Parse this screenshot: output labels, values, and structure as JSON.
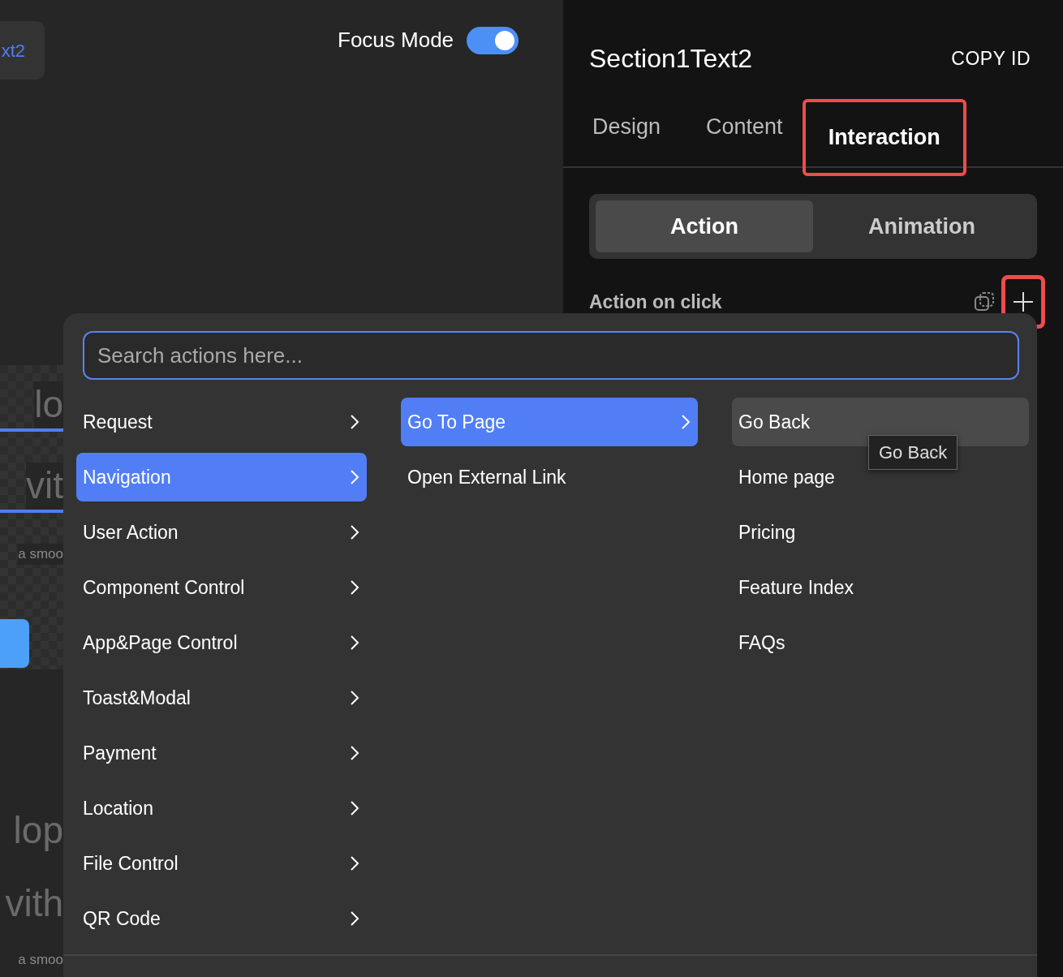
{
  "canvas": {
    "element_tag": "xt2",
    "focus_mode": {
      "label": "Focus Mode",
      "on": true
    },
    "fragments": [
      {
        "kind": "heading",
        "text": "lo"
      },
      {
        "kind": "heading",
        "text": "vit"
      },
      {
        "kind": "caption",
        "text": "a smoo"
      },
      {
        "kind": "button"
      },
      {
        "kind": "heading",
        "text": "lop"
      },
      {
        "kind": "heading",
        "text": "vith"
      },
      {
        "kind": "caption",
        "text": "a smoo"
      }
    ]
  },
  "panel": {
    "title": "Section1Text2",
    "copy_id": "COPY ID",
    "tabs": [
      {
        "label": "Design",
        "selected": false,
        "highlighted": false
      },
      {
        "label": "Content",
        "selected": false,
        "highlighted": false
      },
      {
        "label": "Interaction",
        "selected": true,
        "highlighted": true
      }
    ],
    "segments": [
      {
        "label": "Action",
        "selected": true
      },
      {
        "label": "Animation",
        "selected": false
      }
    ],
    "action_label": "Action on click",
    "add_highlighted": true
  },
  "menu": {
    "placeholder": "Search actions here...",
    "categories": [
      {
        "label": "Request",
        "selected": false
      },
      {
        "label": "Navigation",
        "selected": true
      },
      {
        "label": "User Action",
        "selected": false
      },
      {
        "label": "Component Control",
        "selected": false
      },
      {
        "label": "App&Page Control",
        "selected": false
      },
      {
        "label": "Toast&Modal",
        "selected": false
      },
      {
        "label": "Payment",
        "selected": false
      },
      {
        "label": "Location",
        "selected": false
      },
      {
        "label": "File Control",
        "selected": false
      },
      {
        "label": "QR Code",
        "selected": false
      }
    ],
    "actions": [
      {
        "label": "Go To Page",
        "selected": true,
        "submenu": true
      },
      {
        "label": "Open External Link",
        "selected": false,
        "submenu": false
      }
    ],
    "pages": [
      {
        "label": "Go Back",
        "hovered": true
      },
      {
        "label": "Home page",
        "hovered": false
      },
      {
        "label": "Pricing",
        "hovered": false
      },
      {
        "label": "Feature Index",
        "hovered": false
      },
      {
        "label": "FAQs",
        "hovered": false
      }
    ],
    "tooltip": "Go Back"
  }
}
